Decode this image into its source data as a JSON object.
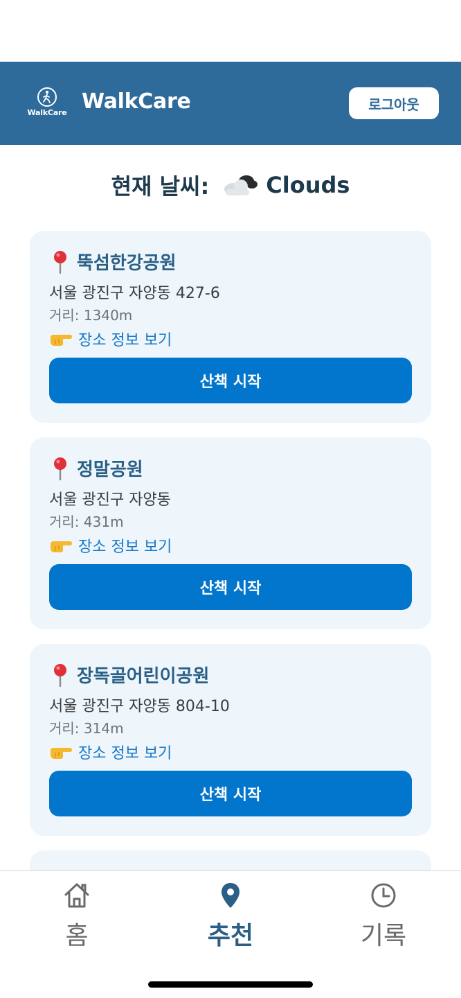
{
  "header": {
    "logo_text": "WalkCare",
    "title": "WalkCare",
    "logout_label": "로그아웃",
    "background_color": "#2f6b9a"
  },
  "weather": {
    "label": "현재 날씨:",
    "icon": "cloud-icon",
    "value": "Clouds"
  },
  "places": [
    {
      "name": "뚝섬한강공원",
      "address": "서울 광진구 자양동 427-6",
      "distance": "거리: 1340m",
      "link_label": "장소 정보 보기",
      "button_label": "산책 시작"
    },
    {
      "name": "정말공원",
      "address": "서울 광진구 자양동",
      "distance": "거리: 431m",
      "link_label": "장소 정보 보기",
      "button_label": "산책 시작"
    },
    {
      "name": "장독골어린이공원",
      "address": "서울 광진구 자양동 804-10",
      "distance": "거리: 314m",
      "link_label": "장소 정보 보기",
      "button_label": "산책 시작"
    }
  ],
  "nav": {
    "items": [
      {
        "label": "홈",
        "icon": "home-icon",
        "active": false
      },
      {
        "label": "추천",
        "icon": "map-pin-icon",
        "active": true
      },
      {
        "label": "기록",
        "icon": "clock-icon",
        "active": false
      }
    ]
  },
  "colors": {
    "accent": "#0276cc",
    "card_background": "#eef6fc",
    "title_text": "#2a5f86"
  }
}
